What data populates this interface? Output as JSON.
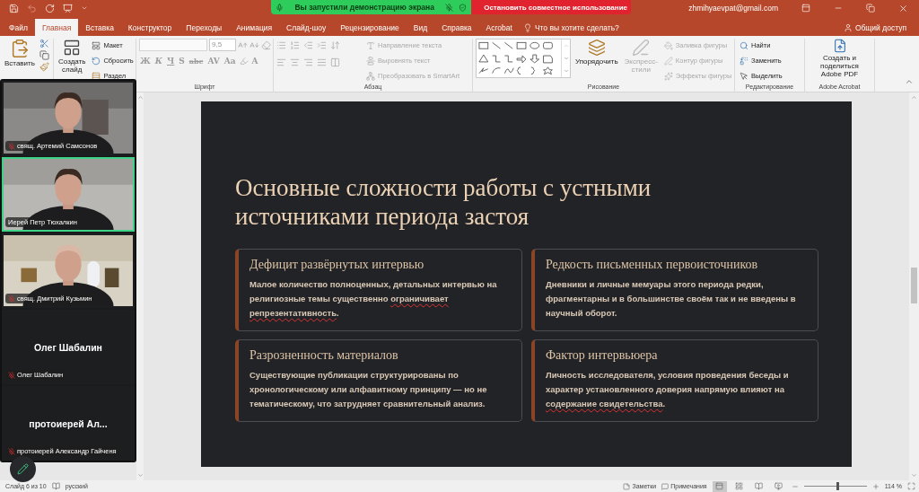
{
  "share_banner": {
    "message": "Вы запустили демонстрацию экрана",
    "stop_button": "Остановить совместное использование"
  },
  "account": "zhmihyaevpat@gmail.com",
  "tabs": [
    {
      "label": "Файл",
      "selected": false
    },
    {
      "label": "Главная",
      "selected": true
    },
    {
      "label": "Вставка",
      "selected": false
    },
    {
      "label": "Конструктор",
      "selected": false
    },
    {
      "label": "Переходы",
      "selected": false
    },
    {
      "label": "Анимация",
      "selected": false
    },
    {
      "label": "Слайд-шоу",
      "selected": false
    },
    {
      "label": "Рецензирование",
      "selected": false
    },
    {
      "label": "Вид",
      "selected": false
    },
    {
      "label": "Справка",
      "selected": false
    },
    {
      "label": "Acrobat",
      "selected": false
    }
  ],
  "tell_me": {
    "placeholder": "Что вы хотите сделать?"
  },
  "share_button": "Общий доступ",
  "ribbon": {
    "clipboard": {
      "paste": "Вставить"
    },
    "slides": {
      "new_slide": "Создать слайд",
      "layout": "Макет",
      "reset": "Сбросить",
      "section": "Раздел"
    },
    "font": {
      "label": "Шрифт",
      "disabled": true,
      "font_size": "9,5",
      "format_buttons": [
        "Ж",
        "К",
        "Ч",
        "S",
        "abc",
        "AV",
        "Aa"
      ],
      "color_button": "A"
    },
    "paragraph": {
      "label": "Абзац",
      "disabled": true,
      "buttons": [
        "Направление текста",
        "Выровнять текст",
        "Преобразовать в SmartArt"
      ]
    },
    "drawing": {
      "label": "Рисование",
      "arrange": "Упорядочить",
      "quick_styles": {
        "label": "Экспресс-стили",
        "disabled": true
      },
      "shape_buttons": [
        {
          "label": "Заливка фигуры",
          "disabled": true
        },
        {
          "label": "Контур фигуры",
          "disabled": true
        },
        {
          "label": "Эффекты фигуры",
          "disabled": true
        }
      ]
    },
    "editing": {
      "label": "Редактирование",
      "find": "Найти",
      "replace": "Заменить",
      "select": "Выделить"
    },
    "acrobat": {
      "label": "Adobe Acrobat",
      "create": "Создать и поделиться Adobe PDF"
    }
  },
  "participants": [
    {
      "kind": "video",
      "name": "свящ. Артемий Самсонов",
      "muted": true,
      "speaking": false
    },
    {
      "kind": "video",
      "name": "Иерей Петр Тюхалкин",
      "muted": false,
      "speaking": true
    },
    {
      "kind": "video",
      "name": "свящ. Дмитрий Кузьмин",
      "muted": true,
      "speaking": false
    },
    {
      "kind": "avatar",
      "display_name": "Олег Шабалин",
      "name": "Олег Шабалин",
      "muted": true,
      "speaking": false
    },
    {
      "kind": "avatar",
      "display_name": "протоиерей Ал...",
      "name": "протоиерей Александр Гайченя",
      "muted": true,
      "speaking": false
    }
  ],
  "slide": {
    "title": "Основные сложности работы с устными источниками периода застоя",
    "cards": [
      {
        "heading": "Дефицит развёрнутых интервью",
        "body": [
          {
            "text": "Малое количество полноценных, детальных интервью на религиозные темы существенно ",
            "flagged": false
          },
          {
            "text": "ограничивает репрезентативность",
            "flagged": true
          },
          {
            "text": ".",
            "flagged": false
          }
        ]
      },
      {
        "heading": "Редкость письменных первоисточников",
        "body": [
          {
            "text": "Дневники и личные мемуары этого периода редки, фрагментарны и в большинстве своём так и не введены в научный оборот.",
            "flagged": false
          }
        ]
      },
      {
        "heading": "Разрозненность материалов",
        "body": [
          {
            "text": "Существующие публикации структурированы по хронологическому или алфавитному принципу — но не тематическому, что затрудняет сравнительный анализ.",
            "flagged": false
          }
        ]
      },
      {
        "heading": "Фактор интервьюера",
        "body": [
          {
            "text": "Личность исследователя, условия проведения беседы и характер установленного доверия напрямую влияют на ",
            "flagged": false
          },
          {
            "text": "содержание свидетельства",
            "flagged": true
          },
          {
            "text": ".",
            "flagged": false
          }
        ]
      }
    ]
  },
  "status_bar": {
    "slide_counter": "Слайд 6 из 10",
    "language": "русский",
    "notes": "Заметки",
    "comments": "Примечания",
    "views": [
      {
        "selected": true
      },
      {
        "selected": false
      },
      {
        "selected": false
      },
      {
        "selected": false
      }
    ],
    "zoom": {
      "level": 0.54,
      "reading": "114 %"
    }
  }
}
